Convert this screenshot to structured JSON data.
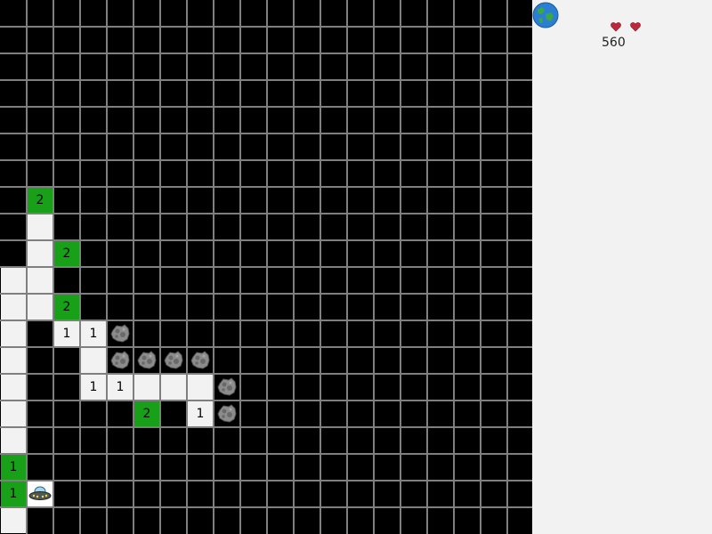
{
  "sidebar": {
    "score": "560",
    "lives": 2,
    "earth_icon": "earth-icon",
    "life_icon": "heart-icon"
  },
  "board": {
    "cols": 20,
    "rows": 20,
    "cells": [
      {
        "row": 7,
        "col": 1,
        "type": "flag",
        "label": "2"
      },
      {
        "row": 8,
        "col": 1,
        "type": "revealed",
        "label": ""
      },
      {
        "row": 9,
        "col": 1,
        "type": "revealed",
        "label": ""
      },
      {
        "row": 9,
        "col": 2,
        "type": "flag",
        "label": "2"
      },
      {
        "row": 10,
        "col": 0,
        "type": "revealed",
        "label": ""
      },
      {
        "row": 10,
        "col": 1,
        "type": "revealed",
        "label": ""
      },
      {
        "row": 11,
        "col": 0,
        "type": "revealed",
        "label": ""
      },
      {
        "row": 11,
        "col": 1,
        "type": "revealed",
        "label": ""
      },
      {
        "row": 11,
        "col": 2,
        "type": "flag",
        "label": "2"
      },
      {
        "row": 12,
        "col": 0,
        "type": "revealed",
        "label": ""
      },
      {
        "row": 12,
        "col": 2,
        "type": "revealed",
        "label": "1"
      },
      {
        "row": 12,
        "col": 3,
        "type": "revealed",
        "label": "1"
      },
      {
        "row": 12,
        "col": 4,
        "type": "asteroid",
        "label": ""
      },
      {
        "row": 13,
        "col": 0,
        "type": "revealed",
        "label": ""
      },
      {
        "row": 13,
        "col": 3,
        "type": "revealed",
        "label": ""
      },
      {
        "row": 13,
        "col": 4,
        "type": "asteroid",
        "label": ""
      },
      {
        "row": 13,
        "col": 5,
        "type": "asteroid",
        "label": ""
      },
      {
        "row": 13,
        "col": 6,
        "type": "asteroid",
        "label": ""
      },
      {
        "row": 13,
        "col": 7,
        "type": "asteroid",
        "label": ""
      },
      {
        "row": 14,
        "col": 0,
        "type": "revealed",
        "label": ""
      },
      {
        "row": 14,
        "col": 3,
        "type": "revealed",
        "label": "1"
      },
      {
        "row": 14,
        "col": 4,
        "type": "revealed",
        "label": "1"
      },
      {
        "row": 14,
        "col": 5,
        "type": "revealed",
        "label": ""
      },
      {
        "row": 14,
        "col": 6,
        "type": "revealed",
        "label": ""
      },
      {
        "row": 14,
        "col": 7,
        "type": "revealed",
        "label": ""
      },
      {
        "row": 14,
        "col": 8,
        "type": "asteroid",
        "label": ""
      },
      {
        "row": 15,
        "col": 0,
        "type": "revealed",
        "label": ""
      },
      {
        "row": 15,
        "col": 5,
        "type": "flag",
        "label": "2"
      },
      {
        "row": 15,
        "col": 7,
        "type": "revealed",
        "label": "1"
      },
      {
        "row": 15,
        "col": 8,
        "type": "asteroid",
        "label": ""
      },
      {
        "row": 16,
        "col": 0,
        "type": "revealed",
        "label": ""
      },
      {
        "row": 17,
        "col": 0,
        "type": "flag",
        "label": "1"
      },
      {
        "row": 18,
        "col": 0,
        "type": "flag",
        "label": "1"
      },
      {
        "row": 18,
        "col": 1,
        "type": "ufo",
        "label": ""
      },
      {
        "row": 19,
        "col": 0,
        "type": "revealed",
        "label": ""
      }
    ]
  },
  "colors": {
    "board_bg": "#000000",
    "grid": "#7f7f7f",
    "revealed": "#f2f2f2",
    "flag": "#18a018",
    "sidebar_bg": "#f2f2f2"
  }
}
